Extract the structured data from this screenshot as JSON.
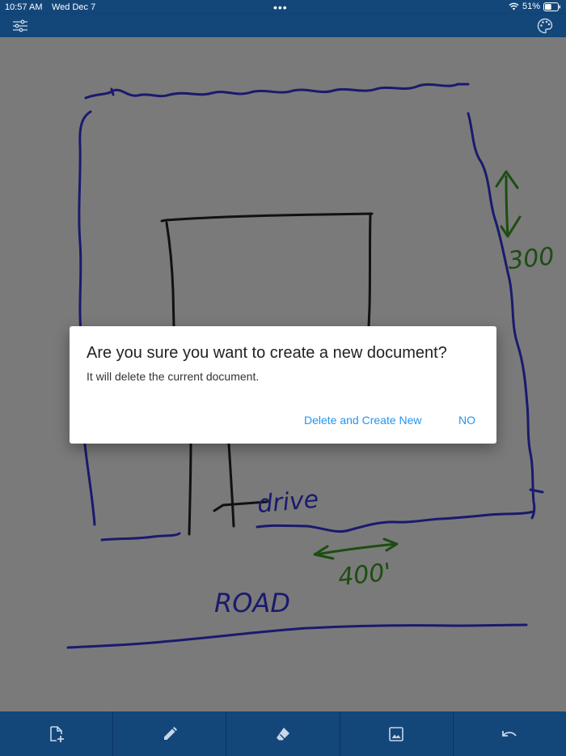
{
  "status_bar": {
    "time": "10:57 AM",
    "date": "Wed Dec 7",
    "multitask_dots": "•••",
    "battery_percent": "51%",
    "wifi_icon": "wifi-icon",
    "battery_level": 0.51
  },
  "toolbar": {
    "settings_icon": "sliders-icon",
    "palette_icon": "palette-icon"
  },
  "drawing": {
    "annotations": {
      "depth": "300",
      "width": "400'",
      "drive": "drive",
      "road": "ROAD"
    },
    "ink_colors": {
      "boundary": "#1a1a6e",
      "building": "#111111",
      "dimensions": "#1d4d12"
    }
  },
  "dialog": {
    "title": "Are you sure you want to create a new document?",
    "message": "It will delete the current document.",
    "confirm_label": "Delete and Create New",
    "cancel_label": "NO",
    "accent_color": "#2196f3"
  },
  "bottom_bar": {
    "items": [
      {
        "icon": "new-document-icon"
      },
      {
        "icon": "pencil-icon"
      },
      {
        "icon": "eraser-icon"
      },
      {
        "icon": "image-icon"
      },
      {
        "icon": "undo-icon"
      }
    ]
  }
}
